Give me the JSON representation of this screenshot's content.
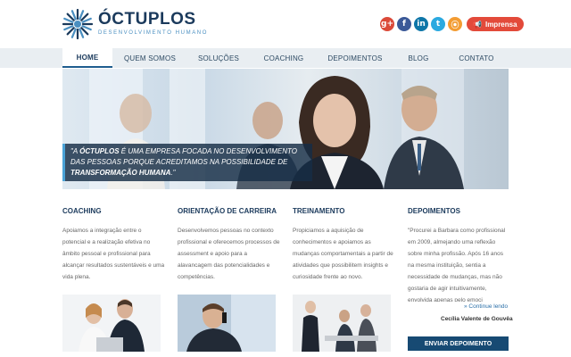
{
  "brand": {
    "name": "ÓCTUPLOS",
    "tagline": "DESENVOLVIMENTO HUMANO",
    "primary_color": "#1b3a5c",
    "accent_color": "#4a8fc1"
  },
  "social": {
    "icons": [
      "google-plus-icon",
      "facebook-icon",
      "linkedin-icon",
      "twitter-icon",
      "rss-icon"
    ],
    "glyphs": [
      "g+",
      "f",
      "in",
      "t",
      "⦿"
    ],
    "press_label": "Imprensa"
  },
  "nav": {
    "items": [
      "HOME",
      "QUEM SOMOS",
      "SOLUÇÕES",
      "COACHING",
      "DEPOIMENTOS",
      "BLOG",
      "CONTATO"
    ],
    "active_index": 0
  },
  "hero": {
    "quote_part1": "\"A ",
    "quote_brand": "ÓCTUPLOS",
    "quote_part2": " É UMA EMPRESA FOCADA NO DESENVOLVIMENTO DAS PESSOAS PORQUE ACREDITAMOS NA POSSIBILIDADE DE ",
    "quote_emphasis": "TRANSFORMAÇÃO HUMANA",
    "quote_end": ".\""
  },
  "columns": [
    {
      "title": "COACHING",
      "text": "Apoiamos a integração entre o potencial e a realização efetiva no âmbito pessoal e profissional para alcançar resultados sustentáveis e uma vida plena."
    },
    {
      "title": "ORIENTAÇÃO DE CARREIRA",
      "text": "Desenvolvemos pessoas no contexto profissional e oferecemos processos de assessment e apoio para a alavancagem das potencialidades e competências."
    },
    {
      "title": "TREINAMENTO",
      "text": "Propiciamos a aquisição de conhecimentos e apoiamos as mudanças comportamentais a partir de atividades que possibilitem insights e curiosidade frente ao novo."
    },
    {
      "title": "DEPOIMENTOS",
      "text": "\"Procurei a Barbara como profissional em 2009, almejando uma reflexão sobre minha profissão. Após 16 anos na mesma instituição, sentia a necessidade de mudanças, mas não gostaria de agir intuitivamente, envolvida apenas pelo emoci"
    }
  ],
  "testimonial": {
    "more_link": "» Continue lendo",
    "author": "Cecília Valente de Gouvêa",
    "button": "ENVIAR DEPOIMENTO"
  }
}
